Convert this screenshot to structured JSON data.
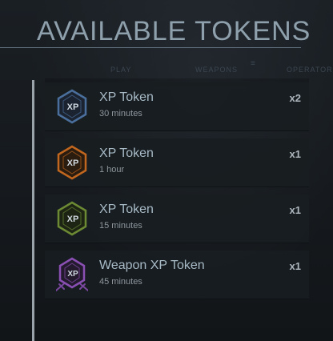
{
  "header": {
    "title": "AVAILABLE TOKENS"
  },
  "nav": {
    "items": [
      "PLAY",
      "WEAPONS",
      "OPERATORS"
    ]
  },
  "tokens": [
    {
      "name": "XP Token",
      "duration": "30 minutes",
      "quantity": "x2",
      "color": "#4a6f9c",
      "icon": "xp-token-icon-blue",
      "icon_text": "XP"
    },
    {
      "name": "XP Token",
      "duration": "1 hour",
      "quantity": "x1",
      "color": "#c0661e",
      "icon": "xp-token-icon-orange",
      "icon_text": "XP"
    },
    {
      "name": "XP Token",
      "duration": "15 minutes",
      "quantity": "x1",
      "color": "#6c8a33",
      "icon": "xp-token-icon-green",
      "icon_text": "XP"
    },
    {
      "name": "Weapon XP Token",
      "duration": "45 minutes",
      "quantity": "x1",
      "color": "#8a4fb3",
      "icon": "weapon-xp-token-icon-purple",
      "icon_text": "XP"
    }
  ]
}
